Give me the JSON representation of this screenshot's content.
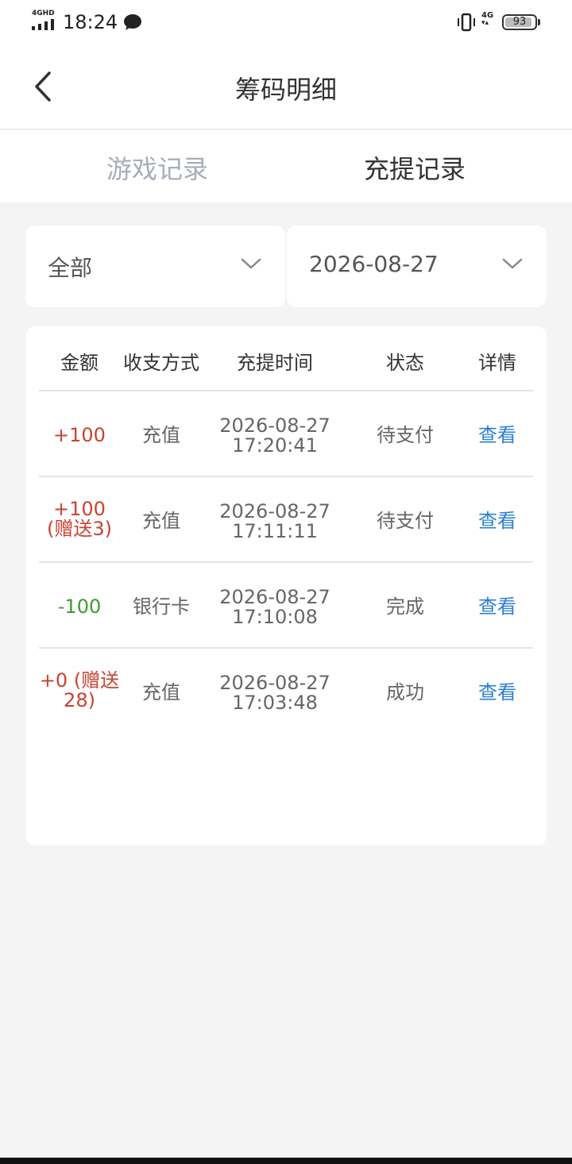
{
  "status_bar": {
    "network": "4GHD",
    "time": "18:24",
    "mobile": "4G",
    "battery": "93",
    "battery_level": 0.93,
    "icons": [
      "signal-icon",
      "message-icon",
      "vibrate-icon",
      "battery-icon"
    ]
  },
  "header": {
    "title": "筹码明细",
    "back_icon": "back-arrow-icon"
  },
  "tabs": [
    {
      "label": "游戏记录",
      "active": false
    },
    {
      "label": "充提记录",
      "active": true
    }
  ],
  "filters": {
    "type": "全部",
    "date": "2026-08-27",
    "dropdown_icon": "chevron-down-icon"
  },
  "table": {
    "headers": [
      "金额",
      "收支方式",
      "充提时间",
      "状态",
      "详情"
    ],
    "rows": [
      {
        "amount": [
          "+100"
        ],
        "method": "充值",
        "date": "2026-08-27",
        "time": "17:20:41",
        "status": "待支付",
        "detail": "查看"
      },
      {
        "amount": [
          "+100",
          "(赠送3)"
        ],
        "method": "充值",
        "date": "2026-08-27",
        "time": "17:11:11",
        "status": "待支付",
        "detail": "查看"
      },
      {
        "amount": [
          "-100"
        ],
        "method": "银行卡",
        "date": "2026-08-27",
        "time": "17:10:08",
        "status": "完成",
        "detail": "查看"
      },
      {
        "amount": [
          "+0 (赠送",
          "28)"
        ],
        "method": "充值",
        "date": "2026-08-27",
        "time": "17:03:48",
        "status": "成功",
        "detail": "查看"
      }
    ]
  },
  "colors": {
    "positive": "#c94330",
    "negative": "#3f9c2f",
    "link": "#2a7fd4",
    "tab_inactive": "#a6aeb9",
    "background": "#f4f4f4"
  }
}
